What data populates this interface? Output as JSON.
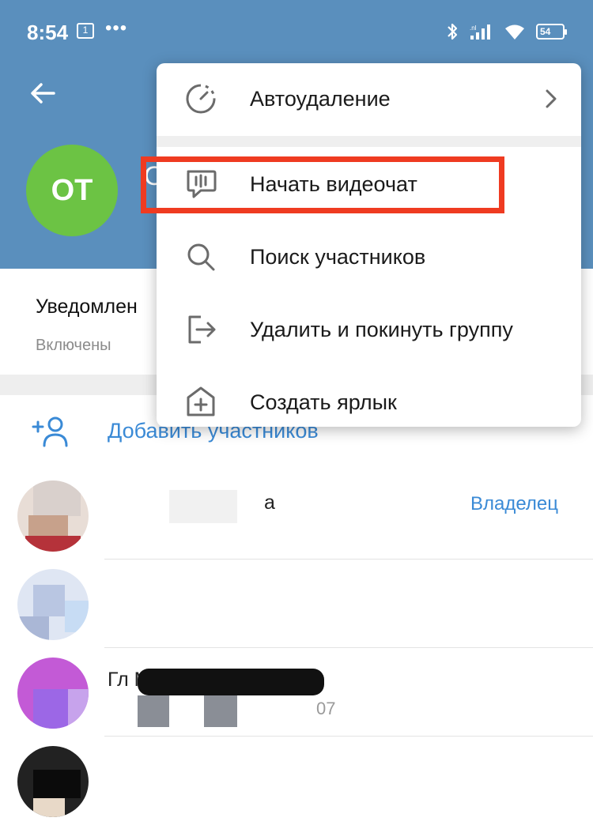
{
  "status_bar": {
    "time": "8:54",
    "notification_badge": "1",
    "more_dots": "•••",
    "battery": "54",
    "icons": [
      "bluetooth-icon",
      "signal-icon",
      "wifi-icon",
      "battery-icon"
    ]
  },
  "header": {
    "avatar_initials": "OT",
    "avatar_color": "#6cc344",
    "background_color": "#5a8fbd",
    "title_fragment": "О"
  },
  "notifications": {
    "title": "Уведомлен",
    "value": "Включены"
  },
  "members": {
    "add_label": "Добавить участников",
    "rows": [
      {
        "name": "а",
        "subtitle": "",
        "role": "Владелец"
      },
      {
        "name": "",
        "subtitle": "",
        "role": ""
      },
      {
        "name": "Гл  Мег",
        "subtitle": "07",
        "role": ""
      },
      {
        "name": "",
        "subtitle": "",
        "role": ""
      }
    ]
  },
  "menu": {
    "items": [
      {
        "label": "Автоудаление",
        "icon": "timer-icon",
        "has_submenu": true
      },
      {
        "label": "Начать видеочат",
        "icon": "voice-chat-icon",
        "highlighted": true
      },
      {
        "label": "Поиск участников",
        "icon": "search-icon"
      },
      {
        "label": "Удалить и покинуть группу",
        "icon": "leave-icon"
      },
      {
        "label": "Создать ярлык",
        "icon": "add-shortcut-icon"
      }
    ]
  },
  "colors": {
    "accent": "#3a8ad6",
    "highlight_border": "#ef3b21"
  }
}
